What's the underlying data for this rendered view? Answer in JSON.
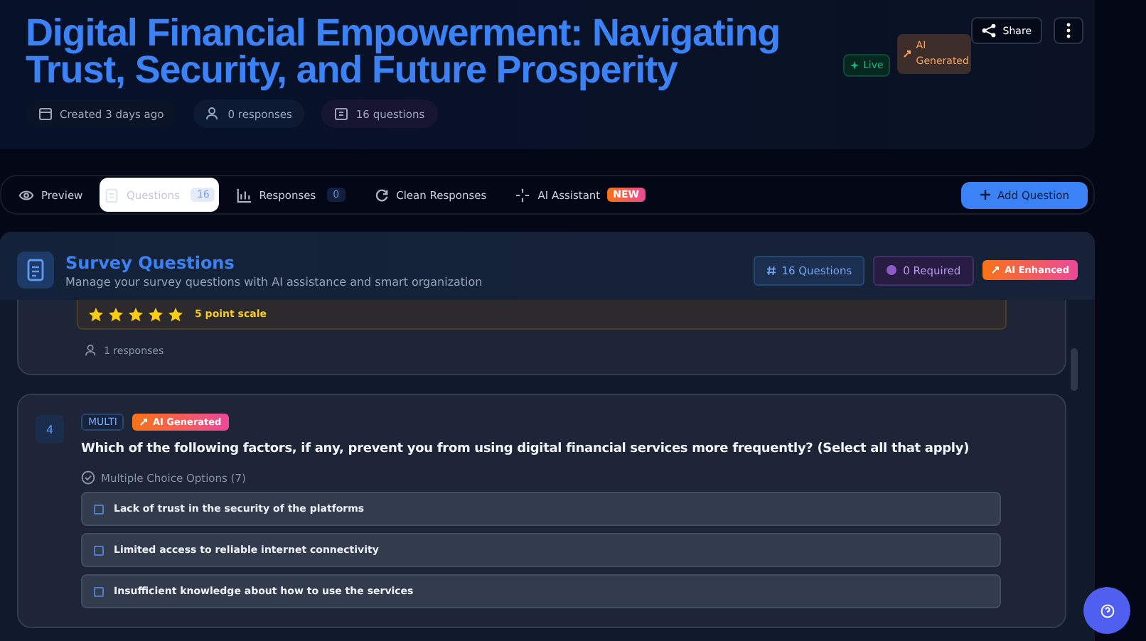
{
  "header": {
    "title": "Digital Financial Empowerment: Navigating Trust, Security, and Future Prosperity",
    "badges": [
      {
        "kind": "live",
        "label": "Live"
      },
      {
        "kind": "ai",
        "label": "AI Generated"
      }
    ],
    "share": "Share",
    "meta": [
      {
        "kind": "calendar",
        "label": "Created 3 days ago"
      },
      {
        "kind": "users",
        "label": "0 responses"
      },
      {
        "kind": "clipboard",
        "label": "16 questions"
      }
    ]
  },
  "tabs": [
    {
      "kind": "eye",
      "label": "Preview",
      "selected": false
    },
    {
      "kind": "list",
      "label": "Questions",
      "count": "16",
      "selected": true
    },
    {
      "kind": "bars",
      "label": "Responses",
      "count": "0",
      "selected": false
    },
    {
      "kind": "refresh",
      "label": "Clean Responses",
      "selected": false
    },
    {
      "kind": "sparkle",
      "label": "AI Assistant",
      "badge": "NEW",
      "selected": false
    }
  ],
  "add_button": "Add Question",
  "section": {
    "title": "Survey Questions",
    "subtitle": "Manage your survey questions with AI assistance and smart organization",
    "chips": [
      {
        "kind": "count",
        "label": "16 Questions"
      },
      {
        "kind": "required",
        "label": "0 Required"
      },
      {
        "kind": "ai",
        "label": "AI Enhanced"
      }
    ]
  },
  "previous_question": {
    "stars": 5,
    "scale": "5 point scale",
    "responses": "1 responses"
  },
  "question": {
    "number": "4",
    "type": "MULTI",
    "ai_badge": "AI Generated",
    "text": "Which of the following factors, if any, prevent you from using digital financial services more frequently? (Select all that apply)",
    "options_label": "Multiple Choice Options (7)",
    "options": [
      {
        "label": "Lack of trust in the security of the platforms",
        "checked": false
      },
      {
        "label": "Limited access to reliable internet connectivity",
        "checked": false
      },
      {
        "label": "Insufficient knowledge about how to use the services",
        "checked": false
      }
    ]
  }
}
